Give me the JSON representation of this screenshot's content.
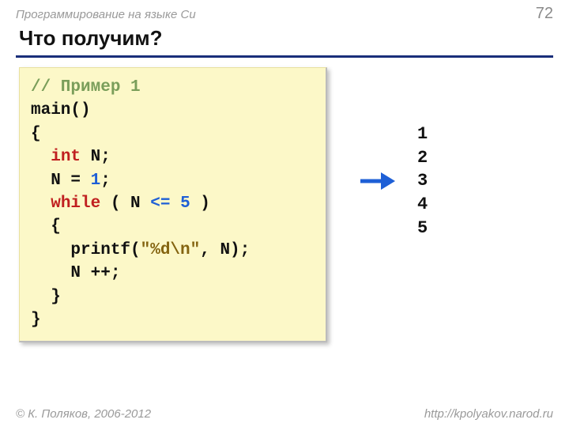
{
  "header": {
    "topic": "Программирование на языке Си",
    "page_number": "72"
  },
  "title": "Что получим?",
  "code": {
    "comment": "// Пример 1",
    "line_main": "main()",
    "brace_open": "{",
    "kw_int": "int",
    "decl_N": " N;",
    "assign_pre": "  N = ",
    "assign_val": "1",
    "assign_post": ";",
    "kw_while": "while",
    "while_pre": " ( N ",
    "while_op": "<=",
    "while_sp": " ",
    "while_val": "5",
    "while_post": " )",
    "inner_open": "  {",
    "printf_pre": "    printf(",
    "printf_str": "\"%d\\n\"",
    "printf_post": ", N);",
    "incr": "    N ++;",
    "inner_close": "  }",
    "brace_close": "}"
  },
  "output": "1\n2\n3\n4\n5",
  "footer": {
    "copyright": "© К. Поляков, 2006-2012",
    "url": "http://kpolyakov.narod.ru"
  }
}
